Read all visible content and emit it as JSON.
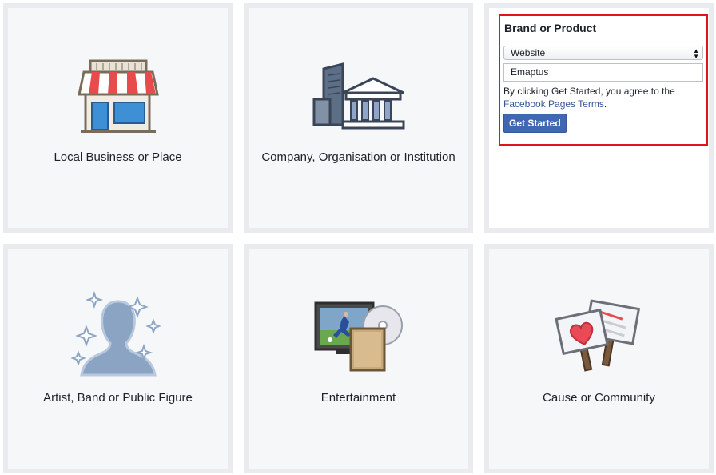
{
  "tiles": {
    "local_business": {
      "label": "Local Business or Place",
      "icon": "storefront-icon"
    },
    "company": {
      "label": "Company, Organisation or Institution",
      "icon": "office-buildings-icon"
    },
    "artist": {
      "label": "Artist, Band or Public Figure",
      "icon": "silhouette-sparkles-icon"
    },
    "entertainment": {
      "label": "Entertainment",
      "icon": "tv-disc-book-icon"
    },
    "cause": {
      "label": "Cause or Community",
      "icon": "protest-signs-icon"
    }
  },
  "brand_form": {
    "title": "Brand or Product",
    "category_selected": "Website",
    "name_value": "Emaptus",
    "agree_text": "By clicking Get Started, you agree to the",
    "terms_link": "Facebook Pages Terms",
    "terms_suffix": ".",
    "submit_label": "Get Started"
  },
  "colors": {
    "tile_bg": "#f6f7f9",
    "tile_border": "#e9ebee",
    "highlight_border": "#e0141e",
    "button_blue": "#4267b2",
    "link_blue": "#365899"
  }
}
